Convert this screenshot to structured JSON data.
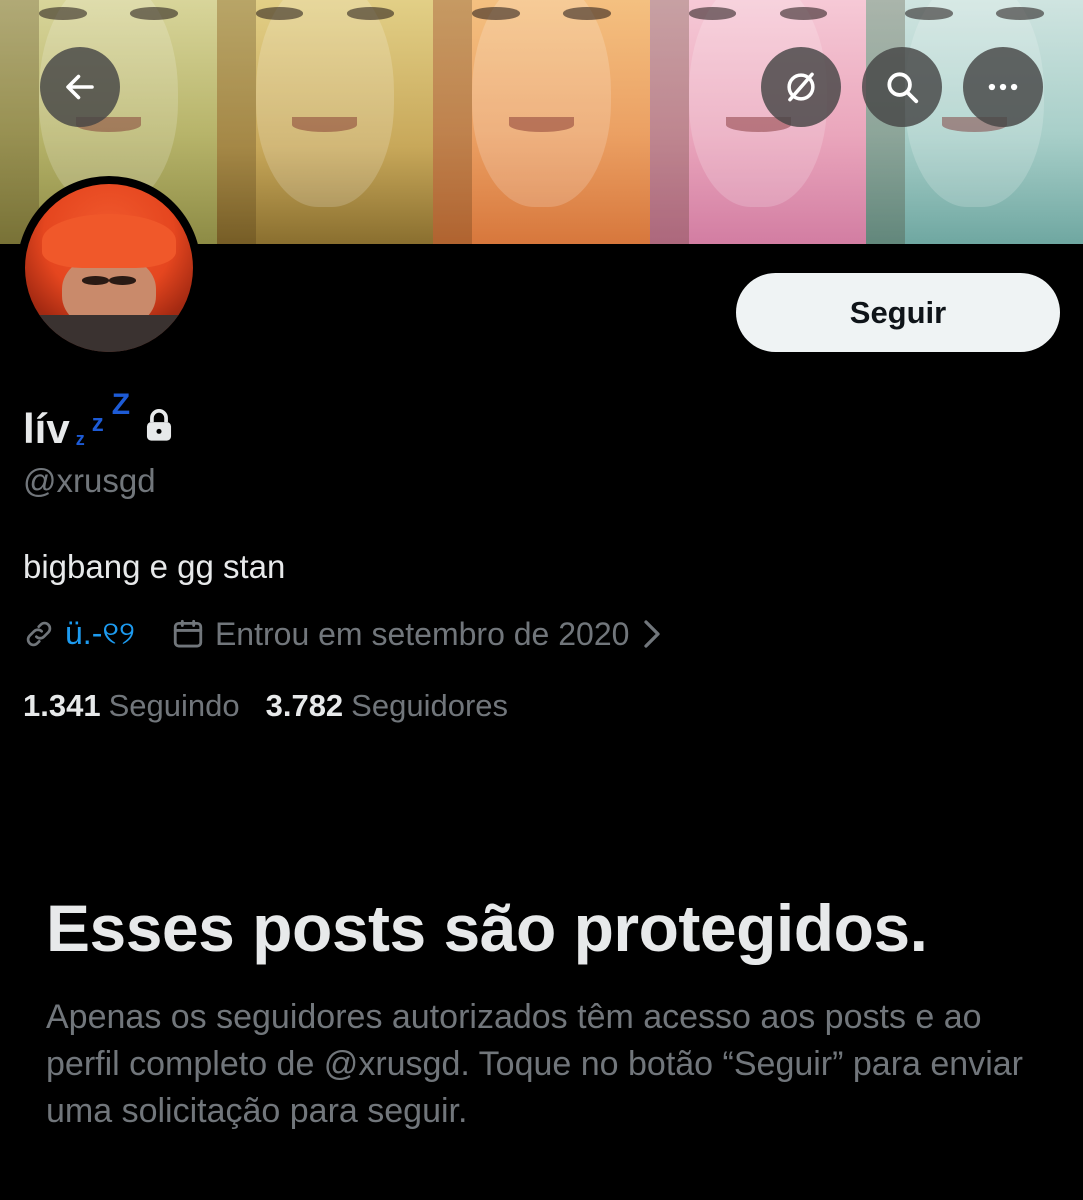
{
  "header": {
    "back_icon": "arrow-left-icon",
    "translate_icon": "globe-slash-icon",
    "search_icon": "search-icon",
    "more_icon": "more-horizontal-icon"
  },
  "profile": {
    "display_name": "lív",
    "name_emoji": "zzz",
    "name_emoji_chars": [
      "z",
      "z",
      "Z"
    ],
    "locked_icon": "lock-icon",
    "handle": "@xrusgd",
    "bio": "bigbang e gg stan",
    "link_text": "ü.-୧୨",
    "joined": "Entrou em setembro de 2020",
    "following_count": "1.341",
    "following_label": "Seguindo",
    "followers_count": "3.782",
    "followers_label": "Seguidores"
  },
  "actions": {
    "follow_label": "Seguir"
  },
  "protected": {
    "title": "Esses posts são protegidos.",
    "description": "Apenas os seguidores autorizados têm acesso aos posts e ao perfil completo de @xrusgd. Toque no botão “Seguir” para enviar uma solicitação para seguir."
  },
  "colors": {
    "background": "#000000",
    "text_primary": "#e7e9ea",
    "text_secondary": "#71767b",
    "link": "#1d9bf0",
    "emoji_blue": "#1d5bd6",
    "follow_bg": "#eff3f4"
  }
}
